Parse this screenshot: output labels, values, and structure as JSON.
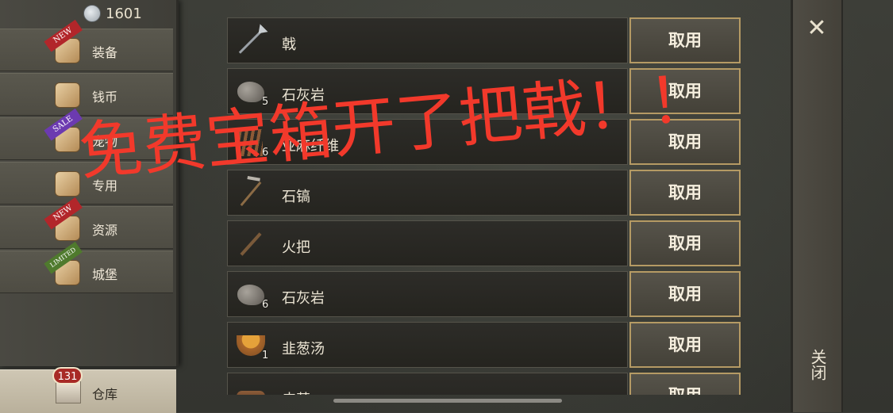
{
  "currency": {
    "icon": "silver-coin-icon",
    "amount": "1601"
  },
  "categories": [
    {
      "label": "装备",
      "icon": "equipment-icon",
      "ribbon": "NEW"
    },
    {
      "label": "钱币",
      "icon": "money-bag-icon",
      "ribbon": ""
    },
    {
      "label": "宠物",
      "icon": "pet-icon",
      "ribbon": "SALE"
    },
    {
      "label": "专用",
      "icon": "banner-icon",
      "ribbon": ""
    },
    {
      "label": "资源",
      "icon": "resources-icon",
      "ribbon": "NEW"
    },
    {
      "label": "城堡",
      "icon": "castle-icon",
      "ribbon": "LIMITED"
    }
  ],
  "warehouse": {
    "label": "仓库",
    "badge": "131",
    "icon": "chest-icon"
  },
  "items": [
    {
      "name": "戟",
      "qty": "",
      "icon": "halberd-icon",
      "button": "取用"
    },
    {
      "name": "石灰岩",
      "qty": "5",
      "icon": "rock-icon",
      "button": "取用"
    },
    {
      "name": "亚麻纤维",
      "qty": "6",
      "icon": "fiber-icon",
      "button": "取用"
    },
    {
      "name": "石镐",
      "qty": "",
      "icon": "pickaxe-icon",
      "button": "取用"
    },
    {
      "name": "火把",
      "qty": "",
      "icon": "torch-icon",
      "button": "取用"
    },
    {
      "name": "石灰岩",
      "qty": "6",
      "icon": "rock-icon",
      "button": "取用"
    },
    {
      "name": "韭葱汤",
      "qty": "1",
      "icon": "soup-icon",
      "button": "取用"
    },
    {
      "name": "皮革",
      "qty": "",
      "icon": "wood-icon",
      "button": "取用"
    }
  ],
  "close": {
    "icon": "close-icon",
    "label": "关闭"
  },
  "overlay_caption": "免费宝箱开了把戟！！"
}
